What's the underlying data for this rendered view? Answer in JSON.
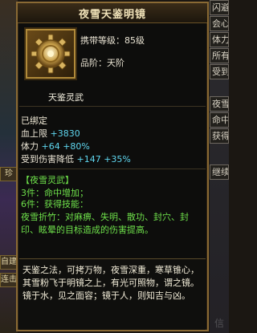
{
  "background": {
    "left_tabs": [
      "",
      "珍",
      "自建",
      "连击"
    ],
    "right_tabs": [
      "闪避",
      "会心",
      "体力",
      "所有",
      "受到",
      "夜雪",
      "命中",
      "获得",
      "继续"
    ]
  },
  "tooltip": {
    "title": "夜雪天鉴明镜",
    "carry_level_label": "携带等级：",
    "carry_level_value": "85级",
    "rank_label": "品阶：",
    "rank_value": "天阶",
    "class_name": "天鉴灵武",
    "bound": "已绑定",
    "stats": [
      {
        "label": "血上限",
        "base": "+3830",
        "bonus": ""
      },
      {
        "label": "体力",
        "base": "+64",
        "bonus": "+80%"
      },
      {
        "label": "受到伤害降低",
        "base": "+147",
        "bonus": "+35%"
      }
    ],
    "set_name": "【夜雪灵武】",
    "set_bonuses": [
      {
        "pieces": "3件：",
        "effect": "命中增加；"
      },
      {
        "pieces": "6件：",
        "effect": "获得技能："
      }
    ],
    "set_skill_desc": "夜雪折竹：对麻痹、失明、散功、封穴、封印、眩晕的目标造成的伤害提高。",
    "lore": "天鉴之法，可拷万物，夜雪深重，寒草锥心，其雪粉飞于明镜之上，有光可照物，谓之镜。镜于水，见之面容；镜于人，则知吉与凶。",
    "icon": "gear-mirror-icon"
  },
  "watermark": "信"
}
